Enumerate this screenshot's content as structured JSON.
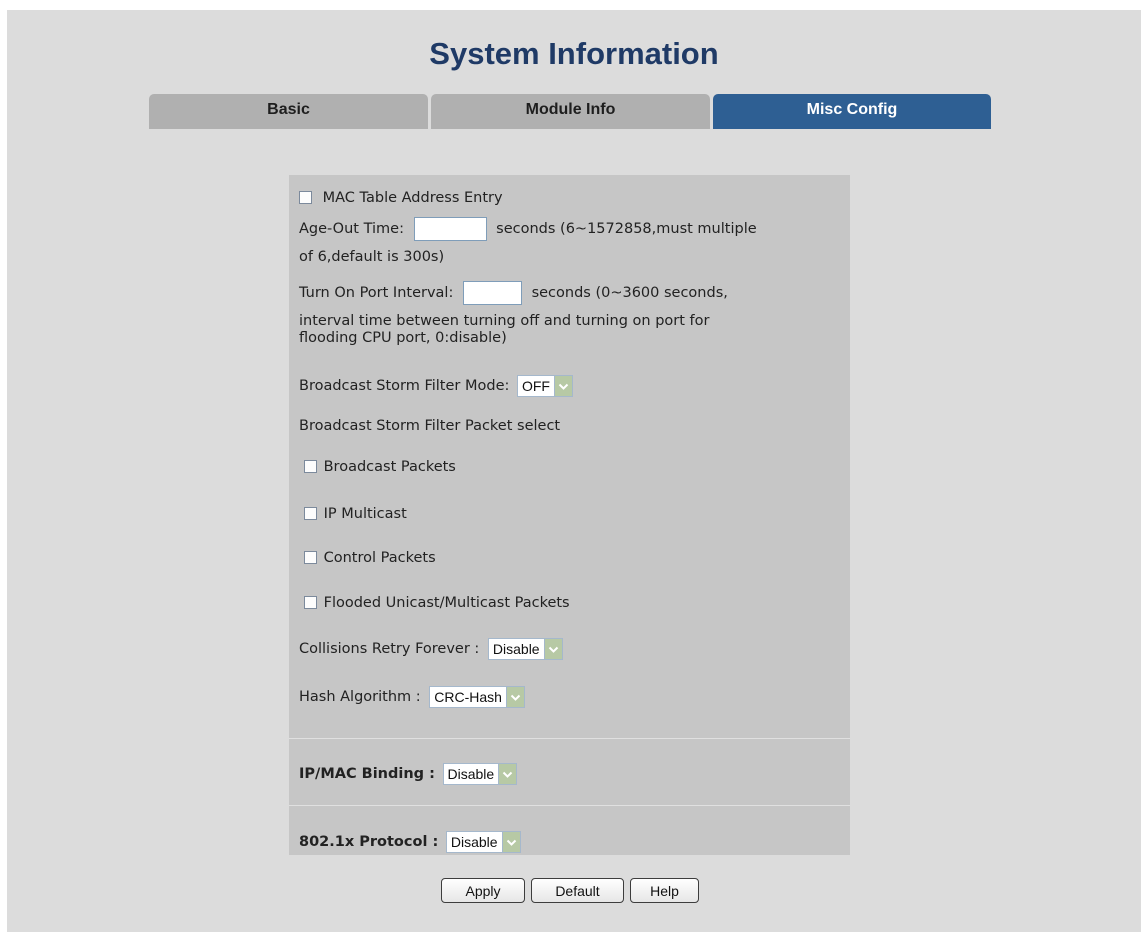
{
  "page": {
    "title": "System Information"
  },
  "tabs": [
    {
      "label": "Basic",
      "active": false
    },
    {
      "label": "Module Info",
      "active": false
    },
    {
      "label": "Misc Config",
      "active": true
    }
  ],
  "colors": {
    "page_bg": "#dcdcdc",
    "panel_bg": "#c6c6c6",
    "tab_inactive": "#b0b0b0",
    "tab_active": "#2e5f93",
    "title": "#1f3a66"
  },
  "form": {
    "mac_table": {
      "label": "MAC Table Address Entry",
      "checked": false
    },
    "age_out": {
      "label": "Age-Out Time:",
      "value": "",
      "hint_line1": "seconds (6~1572858,must multiple",
      "hint_line2": "of 6,default is 300s)"
    },
    "port_interval": {
      "label": "Turn On Port Interval:",
      "value": "",
      "hint_line1": "seconds (0~3600 seconds,",
      "hint_line2": "interval time between turning off and turning on port for",
      "hint_line3": "flooding CPU port, 0:disable)"
    },
    "storm_mode": {
      "label": "Broadcast Storm Filter Mode:",
      "value": "OFF"
    },
    "storm_packet_header": "Broadcast Storm Filter Packet select",
    "packets": [
      {
        "label": "Broadcast Packets",
        "checked": false
      },
      {
        "label": "IP Multicast",
        "checked": false
      },
      {
        "label": "Control Packets",
        "checked": false
      },
      {
        "label": "Flooded Unicast/Multicast Packets",
        "checked": false
      }
    ],
    "collisions": {
      "label": "Collisions Retry Forever :",
      "value": "Disable"
    },
    "hash": {
      "label": "Hash Algorithm :",
      "value": "CRC-Hash"
    },
    "ipmac": {
      "label": "IP/MAC Binding :",
      "value": "Disable"
    },
    "dot1x": {
      "label": "802.1x Protocol :",
      "value": "Disable"
    }
  },
  "buttons": {
    "apply": "Apply",
    "default": "Default",
    "help": "Help"
  }
}
